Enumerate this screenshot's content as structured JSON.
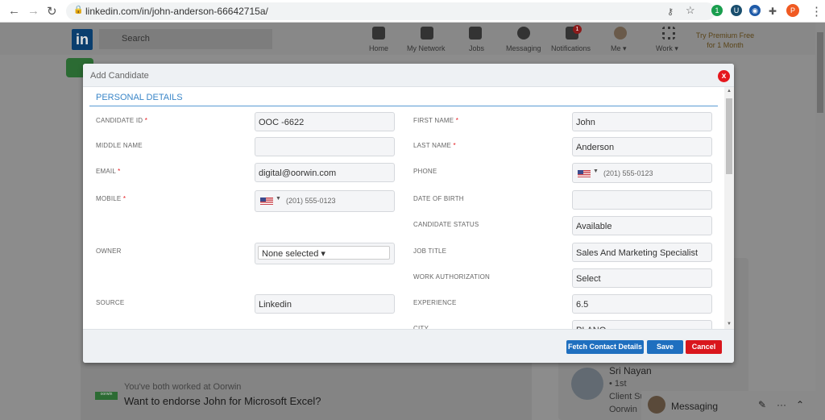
{
  "browser": {
    "url": "linkedin.com/in/john-anderson-66642715a/",
    "profile_initial": "P",
    "ext_badge": "1"
  },
  "linkedin": {
    "logo": "in",
    "search_placeholder": "Search",
    "nav": [
      "Home",
      "My Network",
      "Jobs",
      "Messaging",
      "Notifications",
      "Me ▾",
      "Work ▾"
    ],
    "notif_count": "1",
    "premium_line1": "Try Premium Free",
    "premium_line2": "for 1 Month",
    "endorse": {
      "subtitle": "You've both worked at Oorwin",
      "title": "Want to endorse John for Microsoft Excel?",
      "badge": "oorwin"
    },
    "person": {
      "name": "Sri Nayan",
      "degree": "• 1st",
      "title": "Client Su",
      "company": "Oorwin"
    },
    "messaging": "Messaging"
  },
  "modal": {
    "title": "Add Candidate",
    "close": "x",
    "section": "PERSONAL DETAILS",
    "left": [
      {
        "label": "CANDIDATE ID",
        "required": "*",
        "value": "OOC -6622"
      },
      {
        "label": "MIDDLE NAME",
        "value": ""
      },
      {
        "label": "EMAIL",
        "required": "*",
        "value": "digital@oorwin.com"
      },
      {
        "label": "MOBILE",
        "required": "*",
        "value": "(201) 555-0123"
      },
      {
        "label": "OWNER",
        "value": "None selected ▾"
      },
      {
        "label": "SOURCE",
        "value": "Linkedin"
      }
    ],
    "right": [
      {
        "label": "FIRST NAME",
        "required": "*",
        "value": "John"
      },
      {
        "label": "LAST NAME",
        "required": "*",
        "value": "Anderson"
      },
      {
        "label": "PHONE",
        "value": "(201) 555-0123"
      },
      {
        "label": "DATE OF BIRTH",
        "value": ""
      },
      {
        "label": "CANDIDATE STATUS",
        "value": "Available"
      },
      {
        "label": "JOB TITLE",
        "value": "Sales And Marketing Specialist"
      },
      {
        "label": "WORK AUTHORIZATION",
        "value": "Select"
      },
      {
        "label": "EXPERIENCE",
        "value": "6.5"
      },
      {
        "label": "CITY",
        "value": "PLANO"
      }
    ],
    "buttons": {
      "fetch": "Fetch Contact Details",
      "save": "Save",
      "cancel": "Cancel"
    },
    "colors": {
      "primary": "#1f6fbf",
      "danger": "#d9161c",
      "section": "#3a86c8"
    }
  }
}
